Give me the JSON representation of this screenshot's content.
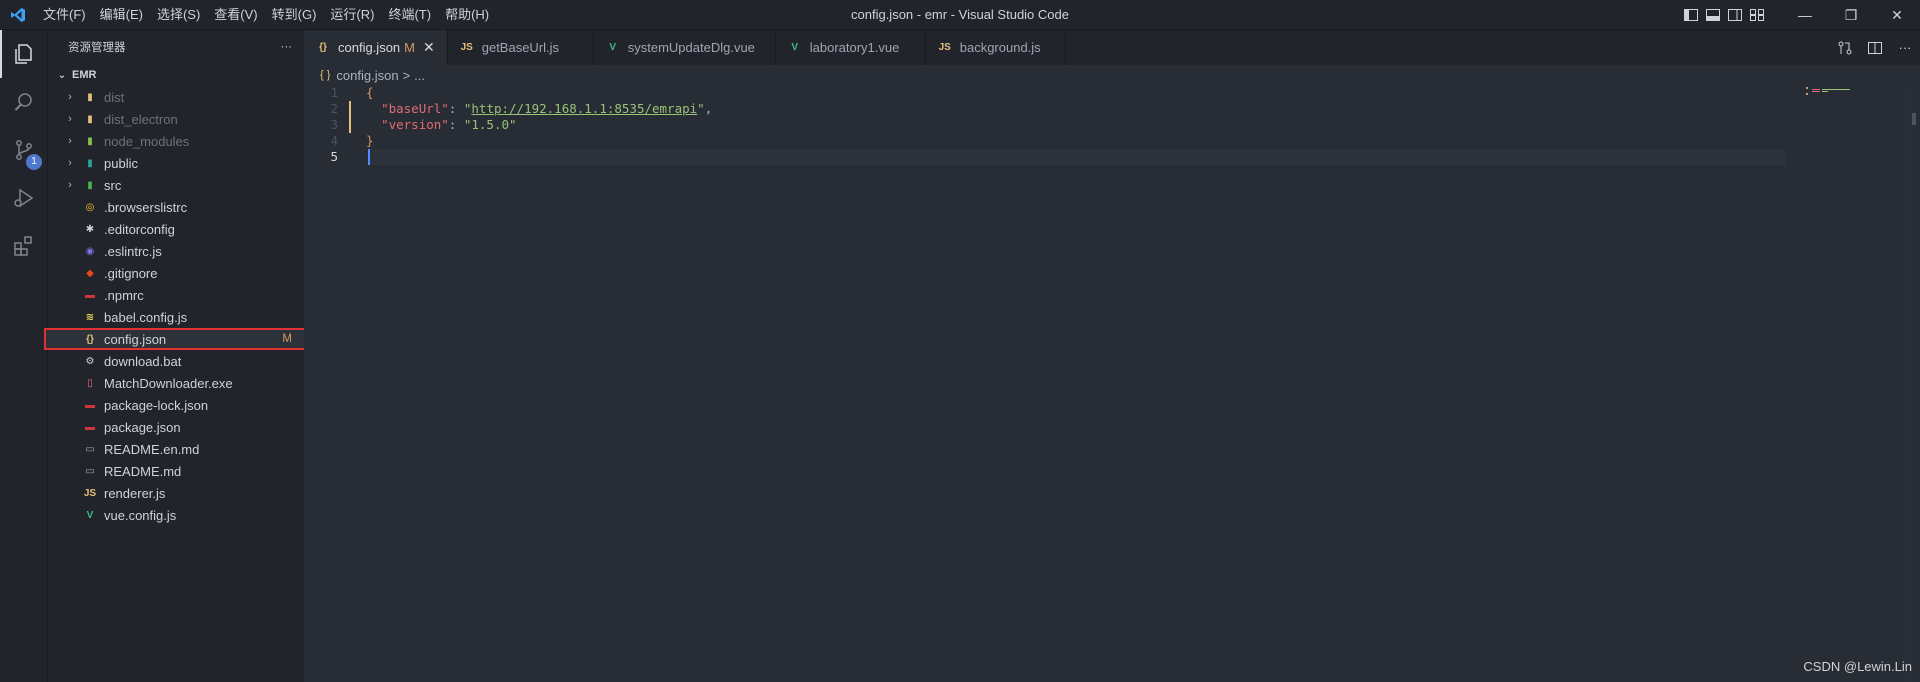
{
  "titlebar": {
    "title": "config.json - emr - Visual Studio Code",
    "menu": [
      "文件(F)",
      "编辑(E)",
      "选择(S)",
      "查看(V)",
      "转到(G)",
      "运行(R)",
      "终端(T)",
      "帮助(H)"
    ]
  },
  "activity": {
    "scm_badge": "1"
  },
  "sidebar": {
    "header": "资源管理器",
    "more": "···",
    "root": "EMR",
    "items": [
      {
        "label": "dist",
        "icon": "folder-icon"
      },
      {
        "label": "dist_electron",
        "icon": "folder-icon"
      },
      {
        "label": "node_modules",
        "icon": "node-folder-icon"
      },
      {
        "label": "public",
        "icon": "public-folder-icon"
      },
      {
        "label": "src",
        "icon": "src-folder-icon"
      },
      {
        "label": ".browserslistrc",
        "icon": "browserslist-icon"
      },
      {
        "label": ".editorconfig",
        "icon": "editorconfig-icon"
      },
      {
        "label": ".eslintrc.js",
        "icon": "eslint-icon"
      },
      {
        "label": ".gitignore",
        "icon": "git-icon"
      },
      {
        "label": ".npmrc",
        "icon": "npm-icon"
      },
      {
        "label": "babel.config.js",
        "icon": "babel-icon"
      },
      {
        "label": "config.json",
        "icon": "json-icon",
        "status": "M"
      },
      {
        "label": "download.bat",
        "icon": "gear-file-icon"
      },
      {
        "label": "MatchDownloader.exe",
        "icon": "exe-icon"
      },
      {
        "label": "package-lock.json",
        "icon": "npm-icon"
      },
      {
        "label": "package.json",
        "icon": "npm-icon"
      },
      {
        "label": "README.en.md",
        "icon": "markdown-icon"
      },
      {
        "label": "README.md",
        "icon": "markdown-icon"
      },
      {
        "label": "renderer.js",
        "icon": "js-icon"
      },
      {
        "label": "vue.config.js",
        "icon": "vue-icon"
      }
    ]
  },
  "tabs": [
    {
      "label": "config.json",
      "icon": "{}",
      "mod": "M",
      "close": "✕"
    },
    {
      "label": "getBaseUrl.js",
      "icon": "JS"
    },
    {
      "label": "systemUpdateDlg.vue",
      "icon": "V"
    },
    {
      "label": "laboratory1.vue",
      "icon": "V"
    },
    {
      "label": "background.js",
      "icon": "JS"
    }
  ],
  "breadcrumb": {
    "file": "config.json",
    "sep": ">",
    "more": "..."
  },
  "code": {
    "line_numbers": [
      "1",
      "2",
      "3",
      "4",
      "5"
    ],
    "open_brace": "{",
    "close_brace": "}",
    "key1": "\"baseUrl\"",
    "colon": ": ",
    "q": "\"",
    "val1": "http://192.168.1.1:8535/emrapi",
    "comma": ",",
    "key2": "\"version\"",
    "val2": "\"1.5.0\""
  },
  "watermark": "CSDN @Lewin.Lin",
  "colors": {
    "accent": "#528bff",
    "modified": "#d19a66",
    "highlight": "#e03232"
  }
}
